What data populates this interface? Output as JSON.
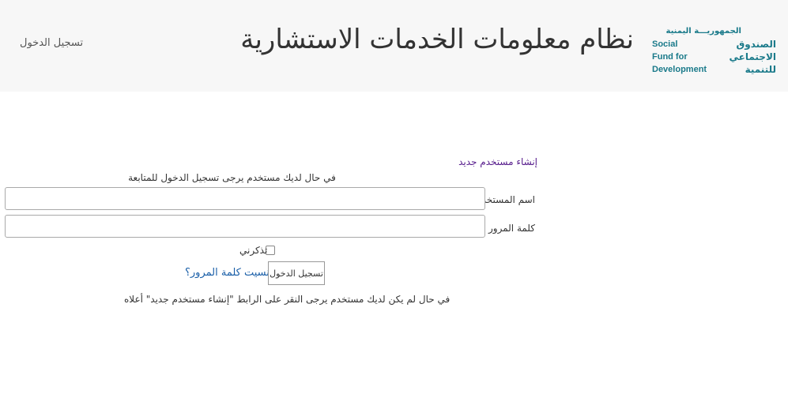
{
  "header": {
    "logo": {
      "arabic_top": "الجمهوريـــة اليمنية",
      "english_lines": [
        "Social",
        "Fund for",
        "Development"
      ],
      "arabic_lines": [
        "الصندوق",
        "الاجتماعي",
        "للتنمية"
      ]
    },
    "title": "نظام معلومات الخدمات الاستشارية",
    "login_link": "تسجيل الدخول"
  },
  "form": {
    "new_user_link": "إنشاء مستخدم جديد",
    "hint": "في حال لديك مستخدم يرجى تسجيل الدخول للمتابعة",
    "username_label": "اسم المستخدم",
    "username_value": "",
    "password_label": "كلمة المرور",
    "password_value": "",
    "remember_label": "تذكرني",
    "remember_checked": false,
    "submit_label": "تسجيل الدخول",
    "forgot_link": "هل نسيت كلمة المرور؟",
    "footer_hint": "في حال لم يكن لديك مستخدم يرجى النقر على الرابط \"إنشاء مستخدم جديد\" أعلاه"
  },
  "colors": {
    "header_bg": "#f7f7f7",
    "logo": "#1a7a8a",
    "link": "#1a5fa8",
    "visited_link": "#551a8b"
  }
}
